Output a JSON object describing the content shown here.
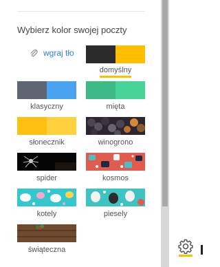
{
  "panel": {
    "title": "Wybierz kolor swojej poczty",
    "upload_label": "wgraj tło",
    "upload_icon": "paperclip-icon"
  },
  "themes": [
    {
      "id": "domyslny",
      "label": "domyślny",
      "selected": true,
      "colors": [
        "#2b2b2b",
        "#ffbf00"
      ]
    },
    {
      "id": "klasyczny",
      "label": "klasyczny",
      "colors": [
        "#5f6572",
        "#4aa3f0"
      ]
    },
    {
      "id": "mieta",
      "label": "mięta",
      "colors": [
        "#3dbb86",
        "#47d397"
      ]
    },
    {
      "id": "slonecznik",
      "label": "słonecznik",
      "colors": [
        "#ffbf13",
        "#ffd13d"
      ]
    },
    {
      "id": "winogrono",
      "label": "winogrono",
      "pattern": "grapes"
    },
    {
      "id": "spider",
      "label": "spider",
      "pattern": "spider"
    },
    {
      "id": "kosmos",
      "label": "kosmos",
      "pattern": "kosmos"
    },
    {
      "id": "kotely",
      "label": "kotely",
      "pattern": "cats"
    },
    {
      "id": "piesely",
      "label": "piesely",
      "pattern": "dogs"
    },
    {
      "id": "swiateczna",
      "label": "świąteczna",
      "pattern": "wood"
    }
  ],
  "settings_icon": "gear-icon",
  "accent": "#f5c400",
  "link_color": "#2f7de1"
}
